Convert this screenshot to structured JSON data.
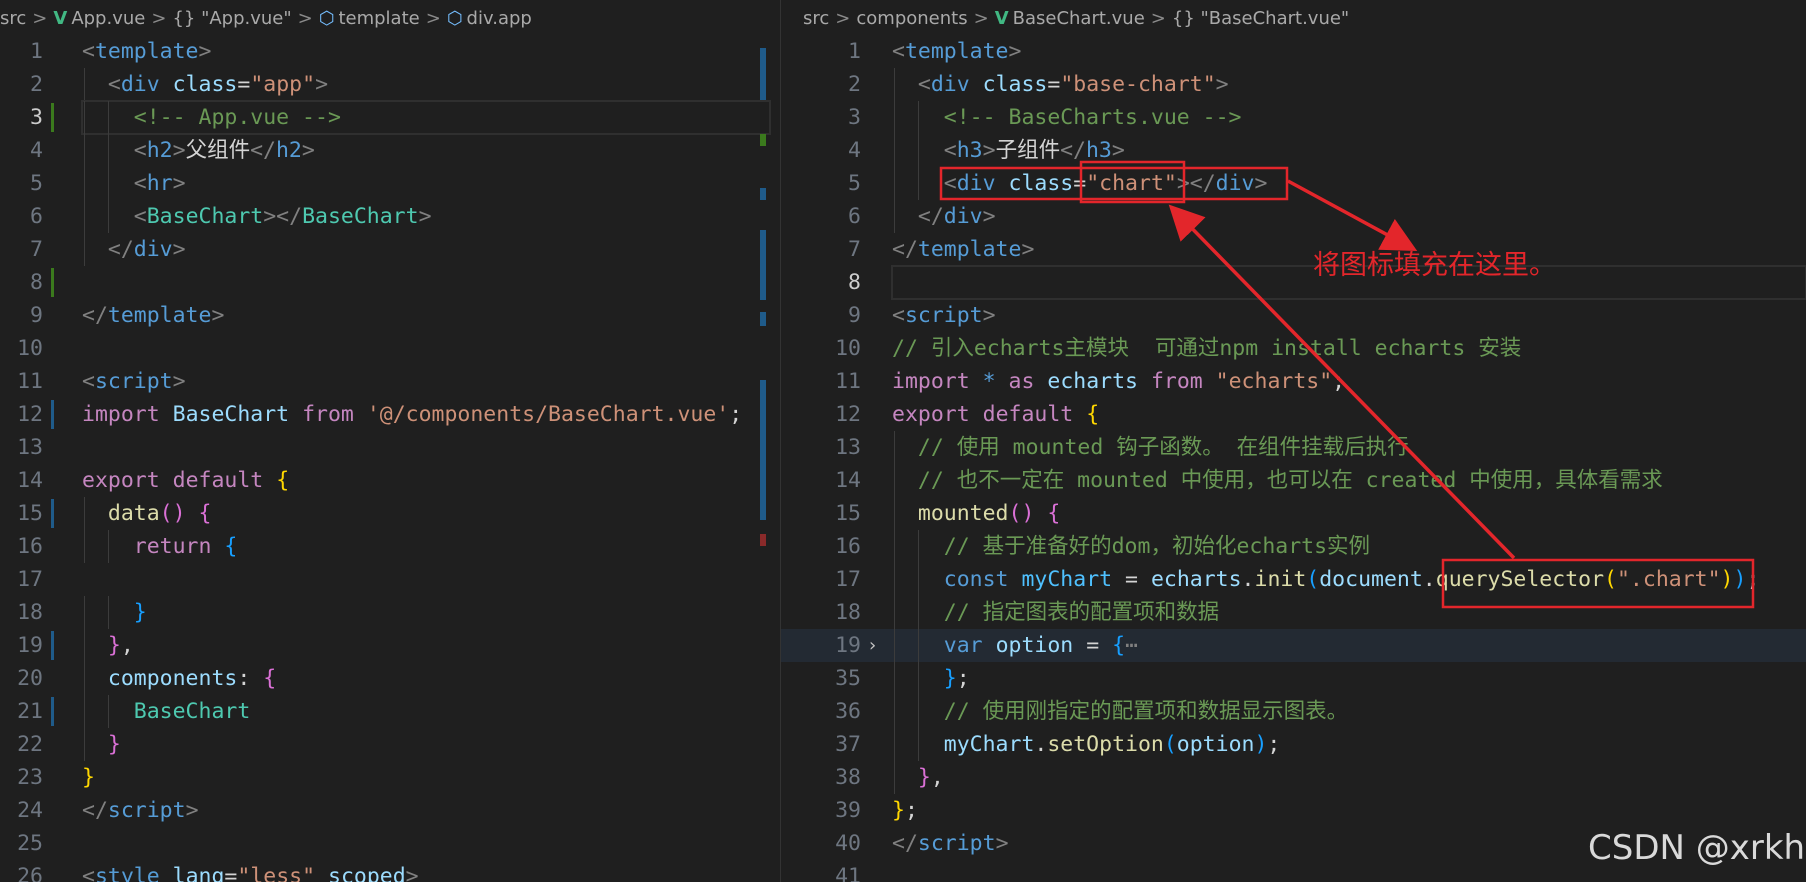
{
  "left": {
    "breadcrumb": [
      "src",
      "App.vue",
      "{} \"App.vue\"",
      "template",
      "div.app"
    ],
    "lines": [
      {
        "n": "1",
        "segs": [
          [
            "<",
            "g"
          ],
          [
            "template",
            "t"
          ],
          [
            ">",
            "g"
          ]
        ]
      },
      {
        "n": "2",
        "segs": [
          [
            "  "
          ],
          [
            "<",
            "g"
          ],
          [
            "div",
            "t"
          ],
          [
            " "
          ],
          [
            "class",
            "a"
          ],
          [
            "=",
            "w"
          ],
          [
            "\"app\"",
            "s"
          ],
          [
            ">",
            "g"
          ]
        ]
      },
      {
        "n": "3",
        "segs": [
          [
            "    "
          ],
          [
            "<!-- App.vue -->",
            "c"
          ]
        ],
        "current": true
      },
      {
        "n": "4",
        "segs": [
          [
            "    "
          ],
          [
            "<",
            "g"
          ],
          [
            "h2",
            "t"
          ],
          [
            ">",
            "g"
          ],
          [
            "父组件",
            "w"
          ],
          [
            "</",
            "g"
          ],
          [
            "h2",
            "t"
          ],
          [
            ">",
            "g"
          ]
        ]
      },
      {
        "n": "5",
        "segs": [
          [
            "    "
          ],
          [
            "<",
            "g"
          ],
          [
            "hr",
            "t"
          ],
          [
            ">",
            "g"
          ]
        ]
      },
      {
        "n": "6",
        "segs": [
          [
            "    "
          ],
          [
            "<",
            "g"
          ],
          [
            "BaseChart",
            "comp"
          ],
          [
            "></",
            "g"
          ],
          [
            "BaseChart",
            "comp"
          ],
          [
            ">",
            "g"
          ]
        ]
      },
      {
        "n": "7",
        "segs": [
          [
            "  "
          ],
          [
            "</",
            "g"
          ],
          [
            "div",
            "t"
          ],
          [
            ">",
            "g"
          ]
        ]
      },
      {
        "n": "8",
        "segs": []
      },
      {
        "n": "9",
        "segs": [
          [
            "</",
            "g"
          ],
          [
            "template",
            "t"
          ],
          [
            ">",
            "g"
          ]
        ]
      },
      {
        "n": "10",
        "segs": []
      },
      {
        "n": "11",
        "segs": [
          [
            "<",
            "g"
          ],
          [
            "script",
            "t"
          ],
          [
            ">",
            "g"
          ]
        ]
      },
      {
        "n": "12",
        "segs": [
          [
            "import",
            "p"
          ],
          [
            " "
          ],
          [
            "BaseChart",
            "v"
          ],
          [
            " "
          ],
          [
            "from",
            "p"
          ],
          [
            " "
          ],
          [
            "'@/components/BaseChart.vue'",
            "s"
          ],
          [
            ";",
            "w"
          ]
        ]
      },
      {
        "n": "13",
        "segs": []
      },
      {
        "n": "14",
        "segs": [
          [
            "export",
            "p"
          ],
          [
            " "
          ],
          [
            "default",
            "p"
          ],
          [
            " "
          ],
          [
            "{",
            "y"
          ]
        ]
      },
      {
        "n": "15",
        "segs": [
          [
            "  "
          ],
          [
            "data",
            "f"
          ],
          [
            "()",
            "m"
          ],
          [
            " "
          ],
          [
            "{",
            "m"
          ]
        ]
      },
      {
        "n": "16",
        "segs": [
          [
            "    "
          ],
          [
            "return",
            "p"
          ],
          [
            " "
          ],
          [
            "{",
            "b"
          ]
        ]
      },
      {
        "n": "17",
        "segs": []
      },
      {
        "n": "18",
        "segs": [
          [
            "    "
          ],
          [
            "}",
            "b"
          ]
        ]
      },
      {
        "n": "19",
        "segs": [
          [
            "  "
          ],
          [
            "}",
            "m"
          ],
          [
            ",",
            "w"
          ]
        ]
      },
      {
        "n": "20",
        "segs": [
          [
            "  "
          ],
          [
            "components",
            "v"
          ],
          [
            ":",
            "w"
          ],
          [
            " "
          ],
          [
            "{",
            "m"
          ]
        ]
      },
      {
        "n": "21",
        "segs": [
          [
            "    "
          ],
          [
            "BaseChart",
            "comp"
          ]
        ]
      },
      {
        "n": "22",
        "segs": [
          [
            "  "
          ],
          [
            "}",
            "m"
          ]
        ]
      },
      {
        "n": "23",
        "segs": [
          [
            "}",
            "y"
          ]
        ]
      },
      {
        "n": "24",
        "segs": [
          [
            "</",
            "g"
          ],
          [
            "script",
            "t"
          ],
          [
            ">",
            "g"
          ]
        ]
      },
      {
        "n": "25",
        "segs": []
      },
      {
        "n": "26",
        "segs": [
          [
            "<",
            "g"
          ],
          [
            "style",
            "t"
          ],
          [
            " "
          ],
          [
            "lang",
            "a"
          ],
          [
            "=",
            "w"
          ],
          [
            "\"less\"",
            "s"
          ],
          [
            " "
          ],
          [
            "scoped",
            "a"
          ],
          [
            ">",
            "g"
          ]
        ]
      }
    ]
  },
  "right": {
    "breadcrumb": [
      "src",
      "components",
      "BaseChart.vue",
      "{} \"BaseChart.vue\""
    ],
    "lines": [
      {
        "n": "1",
        "segs": [
          [
            "<",
            "g"
          ],
          [
            "template",
            "t"
          ],
          [
            ">",
            "g"
          ]
        ]
      },
      {
        "n": "2",
        "segs": [
          [
            "  "
          ],
          [
            "<",
            "g"
          ],
          [
            "div",
            "t"
          ],
          [
            " "
          ],
          [
            "class",
            "a"
          ],
          [
            "=",
            "w"
          ],
          [
            "\"base-chart\"",
            "s"
          ],
          [
            ">",
            "g"
          ]
        ]
      },
      {
        "n": "3",
        "segs": [
          [
            "    "
          ],
          [
            "<!-- BaseCharts.vue -->",
            "c"
          ]
        ]
      },
      {
        "n": "4",
        "segs": [
          [
            "    "
          ],
          [
            "<",
            "g"
          ],
          [
            "h3",
            "t"
          ],
          [
            ">",
            "g"
          ],
          [
            "子组件",
            "w"
          ],
          [
            "</",
            "g"
          ],
          [
            "h3",
            "t"
          ],
          [
            ">",
            "g"
          ]
        ]
      },
      {
        "n": "5",
        "segs": [
          [
            "    "
          ],
          [
            "<",
            "g"
          ],
          [
            "div",
            "t"
          ],
          [
            " "
          ],
          [
            "class",
            "a"
          ],
          [
            "=",
            "w"
          ],
          [
            "\"chart\"",
            "s"
          ],
          [
            "></",
            "g"
          ],
          [
            "div",
            "t"
          ],
          [
            ">",
            "g"
          ]
        ]
      },
      {
        "n": "6",
        "segs": [
          [
            "  "
          ],
          [
            "</",
            "g"
          ],
          [
            "div",
            "t"
          ],
          [
            ">",
            "g"
          ]
        ]
      },
      {
        "n": "7",
        "segs": [
          [
            "</",
            "g"
          ],
          [
            "template",
            "t"
          ],
          [
            ">",
            "g"
          ]
        ]
      },
      {
        "n": "8",
        "segs": [],
        "current": true
      },
      {
        "n": "9",
        "segs": [
          [
            "<",
            "g"
          ],
          [
            "script",
            "t"
          ],
          [
            ">",
            "g"
          ]
        ]
      },
      {
        "n": "10",
        "segs": [
          [
            "// 引入echarts主模块  可通过npm install echarts 安装",
            "c"
          ]
        ]
      },
      {
        "n": "11",
        "segs": [
          [
            "import",
            "p"
          ],
          [
            " "
          ],
          [
            "*",
            "k"
          ],
          [
            " "
          ],
          [
            "as",
            "p"
          ],
          [
            " "
          ],
          [
            "echarts",
            "v"
          ],
          [
            " "
          ],
          [
            "from",
            "p"
          ],
          [
            " "
          ],
          [
            "\"echarts\"",
            "s"
          ],
          [
            ";",
            "w"
          ]
        ]
      },
      {
        "n": "12",
        "segs": [
          [
            "export",
            "p"
          ],
          [
            " "
          ],
          [
            "default",
            "p"
          ],
          [
            " "
          ],
          [
            "{",
            "y"
          ]
        ]
      },
      {
        "n": "13",
        "segs": [
          [
            "  "
          ],
          [
            "// 使用 mounted 钩子函数。 在组件挂载后执行",
            "c"
          ]
        ]
      },
      {
        "n": "14",
        "segs": [
          [
            "  "
          ],
          [
            "// 也不一定在 mounted 中使用，也可以在 created 中使用，具体看需求",
            "c"
          ]
        ]
      },
      {
        "n": "15",
        "segs": [
          [
            "  "
          ],
          [
            "mounted",
            "f"
          ],
          [
            "()",
            "m"
          ],
          [
            " "
          ],
          [
            "{",
            "m"
          ]
        ]
      },
      {
        "n": "16",
        "segs": [
          [
            "    "
          ],
          [
            "// 基于准备好的dom，初始化echarts实例",
            "c"
          ]
        ]
      },
      {
        "n": "17",
        "segs": [
          [
            "    "
          ],
          [
            "const",
            "k"
          ],
          [
            " "
          ],
          [
            "myChart",
            "cn"
          ],
          [
            " "
          ],
          [
            "=",
            "w"
          ],
          [
            " "
          ],
          [
            "echarts",
            "v"
          ],
          [
            ".",
            "w"
          ],
          [
            "init",
            "f"
          ],
          [
            "(",
            "b"
          ],
          [
            "document",
            "v"
          ],
          [
            ".",
            "w"
          ],
          [
            "querySelector",
            "f"
          ],
          [
            "(",
            "y"
          ],
          [
            "\".chart\"",
            "s"
          ],
          [
            ")",
            "y"
          ],
          [
            ")",
            "b"
          ],
          [
            ";",
            "w"
          ]
        ]
      },
      {
        "n": "18",
        "segs": [
          [
            "    "
          ],
          [
            "// 指定图表的配置项和数据",
            "c"
          ]
        ]
      },
      {
        "n": "19",
        "segs": [
          [
            "    "
          ],
          [
            "var",
            "k"
          ],
          [
            " "
          ],
          [
            "option",
            "v"
          ],
          [
            " "
          ],
          [
            "=",
            "w"
          ],
          [
            " "
          ],
          [
            "{",
            "b"
          ],
          [
            "⋯",
            "g"
          ]
        ],
        "folded": true
      },
      {
        "n": "35",
        "segs": [
          [
            "    "
          ],
          [
            "}",
            "b"
          ],
          [
            ";",
            "w"
          ]
        ]
      },
      {
        "n": "36",
        "segs": [
          [
            "    "
          ],
          [
            "// 使用刚指定的配置项和数据显示图表。",
            "c"
          ]
        ]
      },
      {
        "n": "37",
        "segs": [
          [
            "    "
          ],
          [
            "myChart",
            "v"
          ],
          [
            ".",
            "w"
          ],
          [
            "setOption",
            "f"
          ],
          [
            "(",
            "b"
          ],
          [
            "option",
            "v"
          ],
          [
            ")",
            "b"
          ],
          [
            ";",
            "w"
          ]
        ]
      },
      {
        "n": "38",
        "segs": [
          [
            "  "
          ],
          [
            "}",
            "m"
          ],
          [
            ",",
            "w"
          ]
        ]
      },
      {
        "n": "39",
        "segs": [
          [
            "}",
            "y"
          ],
          [
            ";",
            "w"
          ]
        ]
      },
      {
        "n": "40",
        "segs": [
          [
            "</",
            "g"
          ],
          [
            "script",
            "t"
          ],
          [
            ">",
            "g"
          ]
        ]
      },
      {
        "n": "41",
        "segs": []
      }
    ]
  },
  "annotation": {
    "text": "将图标填充在这里。",
    "color": "#e3262b"
  },
  "watermark": "CSDN @xrkhy"
}
